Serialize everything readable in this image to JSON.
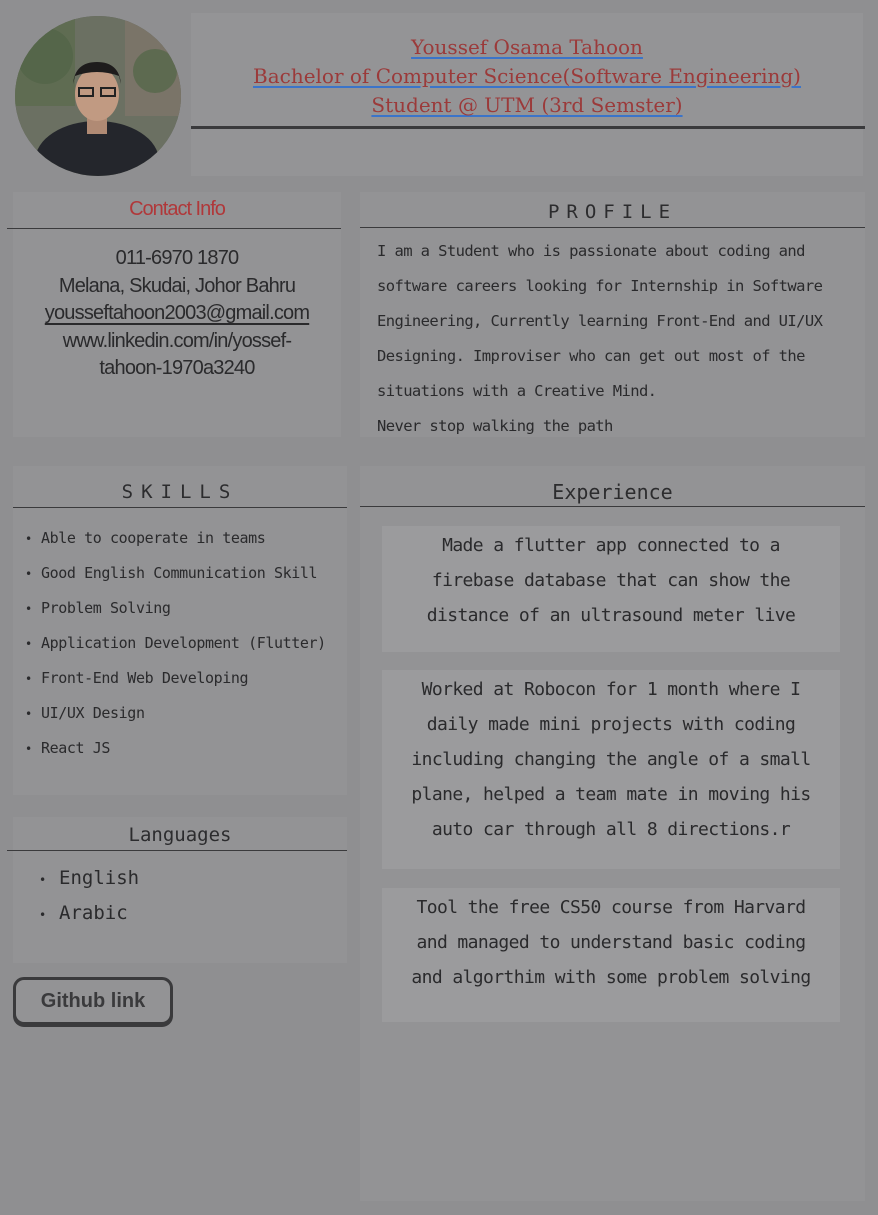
{
  "header": {
    "name": "Youssef Osama Tahoon",
    "degree": "Bachelor of Computer Science(Software Engineering)",
    "status": "Student @ UTM (3rd Semster)"
  },
  "contact": {
    "title": "Contact Info",
    "phone": "011-6970 1870",
    "address": "Melana, Skudai, Johor Bahru",
    "email": "youssef­tahoon2003@gmail.com",
    "linkedin_line1": "www.linkedin.com/in/yossef-",
    "linkedin_line2": "tahoon-1970a3240"
  },
  "profile": {
    "title": "PROFILE",
    "lines": [
      "I am a Student who is passionate about coding and",
      "software careers looking for Internship in Software",
      "Engineering, Currently learning Front-End and UI/UX",
      "Designing. Improviser who can get out most of the",
      "situations with a Creative Mind.",
      "Never stop walking the path"
    ]
  },
  "skills": {
    "title": "SKILLS",
    "items": [
      "Able to cooperate in teams",
      "Good English Communication Skill",
      "Problem Solving",
      "Application Development (Flutter)",
      "Front-End Web Developing",
      "UI/UX Design",
      "React JS"
    ]
  },
  "languages": {
    "title": "Languages",
    "items": [
      "English",
      "Arabic"
    ]
  },
  "github": {
    "label": "Github link"
  },
  "experience": {
    "title": "Experience",
    "cards": [
      [
        "Made a flutter app connected to a",
        "firebase database that can show the",
        "distance of an ultrasound meter live"
      ],
      [
        "Worked at Robocon for 1 month where I",
        "daily made mini projects with coding",
        "including changing the angle of a small",
        "plane, helped a team mate in moving his",
        "auto car through all 8 directions.r"
      ],
      [
        "Tool the free CS50 course from Harvard",
        "and managed to understand basic coding",
        "and algorthim with some problem solving"
      ]
    ]
  }
}
